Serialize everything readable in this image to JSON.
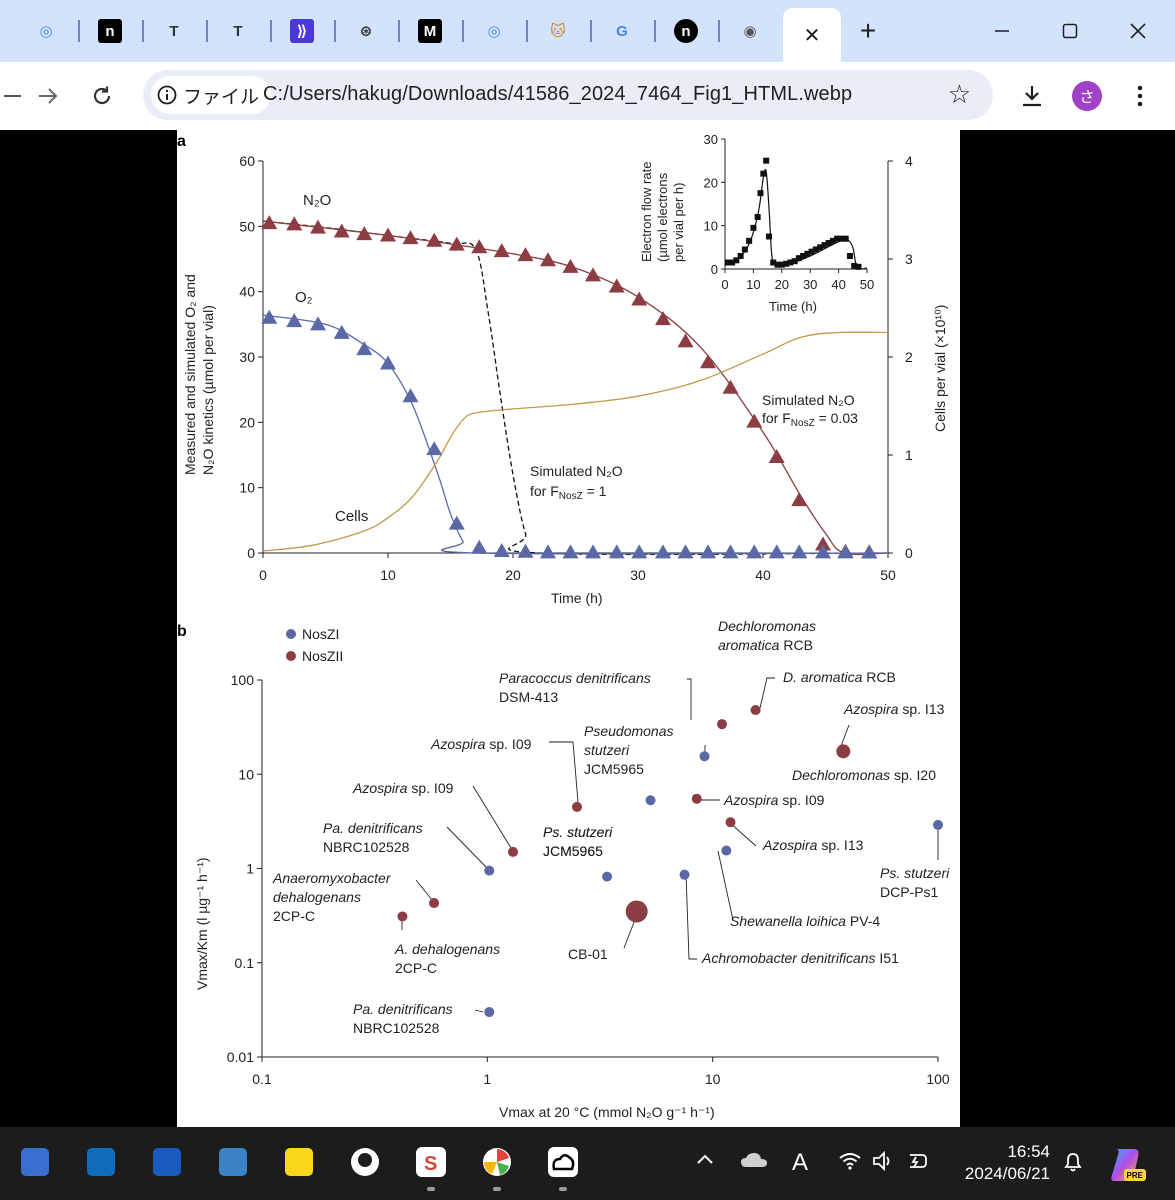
{
  "browser": {
    "tabs": [
      {
        "icon": "pond-icon",
        "glyph": "◎",
        "color": "#3d8fe0"
      },
      {
        "icon": "note-n-icon",
        "glyph": "n",
        "color": "#000000"
      },
      {
        "icon": "text-t-icon",
        "glyph": "T",
        "color": "#333333"
      },
      {
        "icon": "text-t-icon",
        "glyph": "T",
        "color": "#333333"
      },
      {
        "icon": "arrow-chevrons-icon",
        "glyph": "⟫",
        "color": "#4a38d8"
      },
      {
        "icon": "openai-icon",
        "glyph": "⊛",
        "color": "#333333"
      },
      {
        "icon": "m-logo-icon",
        "glyph": "M",
        "color": "#000000"
      },
      {
        "icon": "pond-icon",
        "glyph": "◎",
        "color": "#3d8fe0"
      },
      {
        "icon": "cat-image-icon",
        "glyph": "🐱",
        "color": "#c88a2a"
      },
      {
        "icon": "google-icon",
        "glyph": "G",
        "color": "#4285f4"
      },
      {
        "icon": "n-circle-icon",
        "glyph": "n",
        "color": "#000000"
      },
      {
        "icon": "globe-icon",
        "glyph": "◉",
        "color": "#555555"
      }
    ],
    "active_tab_close": "✕",
    "new_tab": "+",
    "url_chip_label": "ファイル",
    "url": "C:/Users/hakug/Downloads/41586_2024_7464_Fig1_HTML.webp",
    "profile_initial": "さ",
    "accent": "#d3e3fd"
  },
  "figure": {
    "panel_a": {
      "label": "a",
      "left_axis_label_line1": "Measured and simulated O₂ and",
      "left_axis_label_line2": "N₂O kinetics (µmol per vial)",
      "right_axis_label": "Cells per vial (×10¹⁰)",
      "x_axis_label": "Time (h)",
      "label_n2o": "N₂O",
      "label_o2": "O₂",
      "label_cells": "Cells",
      "annot_sim1_line1": "Simulated N₂O",
      "annot_sim1_line2": "for F",
      "annot_sim1_sub": "NosZ",
      "annot_sim1_tail": " = 1",
      "annot_sim2_line1": "Simulated N₂O",
      "annot_sim2_line2": "for F",
      "annot_sim2_sub": "NosZ",
      "annot_sim2_tail": " = 0.03",
      "inset_y_label_1": "Electron flow rate",
      "inset_y_label_2": "(µmol electrons",
      "inset_y_label_3": "per vial per h)",
      "inset_x_label": "Time (h)"
    },
    "panel_b": {
      "label": "b",
      "legend": [
        {
          "name": "NosZI",
          "color": "#5a69a6"
        },
        {
          "name": "NosZII",
          "color": "#8c3c43"
        }
      ],
      "y_axis_label": "Vmax/Km (l µg⁻¹ h⁻¹)",
      "x_axis_label": "Vmax at 20 °C (mmol N₂O g⁻¹ h⁻¹)"
    },
    "colors": {
      "n2o": "#8c3c43",
      "o2": "#5a69a6",
      "cells": "#c19a49",
      "nosz1": "#5a69a6",
      "nosz2": "#8c3c43"
    }
  },
  "chart_data": [
    {
      "type": "scatter",
      "panel": "a",
      "xlabel": "Time (h)",
      "ylabel": "Measured and simulated O2 and N2O kinetics (µmol per vial)",
      "y2label": "Cells per vial (×10^10)",
      "xlim": [
        0,
        50
      ],
      "ylim": [
        0,
        60
      ],
      "y2lim": [
        0,
        4
      ],
      "x_ticks": [
        0,
        10,
        20,
        30,
        40,
        50
      ],
      "y_ticks": [
        0,
        10,
        20,
        30,
        40,
        50,
        60
      ],
      "y2_ticks": [
        0,
        1,
        2,
        3,
        4
      ],
      "series": [
        {
          "name": "N₂O",
          "marker": "triangle",
          "x": [
            0.5,
            2.5,
            4.4,
            6.3,
            8.1,
            10,
            11.8,
            13.7,
            15.5,
            17.3,
            19.1,
            21,
            22.8,
            24.6,
            26.4,
            28.3,
            30.1,
            32,
            33.8,
            35.6,
            37.4,
            39.3,
            41.1,
            42.9,
            44.8,
            46.6,
            48.5
          ],
          "y": [
            50.5,
            50.3,
            49.8,
            49.2,
            48.8,
            48.6,
            48.2,
            47.8,
            47.2,
            46.8,
            46.2,
            45.6,
            44.8,
            43.8,
            42.5,
            40.8,
            38.8,
            35.8,
            32.4,
            29.2,
            25.3,
            20.1,
            14.7,
            8.1,
            1.3,
            0.2,
            0.1
          ]
        },
        {
          "name": "O₂",
          "marker": "triangle",
          "x": [
            0.5,
            2.5,
            4.4,
            6.3,
            8.1,
            10,
            11.8,
            13.7,
            15.5,
            17.3,
            19.1,
            21,
            22.8,
            24.6,
            26.4,
            28.3,
            30.1,
            32,
            33.8,
            35.6,
            37.4,
            39.3,
            41.1,
            42.9,
            44.8,
            46.6,
            48.5
          ],
          "y": [
            36,
            35.5,
            35,
            33.7,
            31.2,
            29,
            24,
            15.9,
            4.5,
            0.8,
            0.3,
            0.2,
            0.1,
            0.1,
            0.1,
            0.1,
            0.1,
            0.1,
            0.1,
            0.1,
            0.1,
            0.1,
            0.1,
            0.1,
            0.1,
            0.1,
            0.1
          ]
        },
        {
          "name": "Simulated N₂O for FNosZ = 1",
          "style": "dashed",
          "x": [
            0,
            5,
            10,
            15,
            17,
            18,
            19,
            20,
            21,
            22,
            50
          ],
          "y": [
            50.8,
            49.8,
            48.6,
            47.4,
            46.5,
            37,
            24,
            12,
            3,
            0,
            0
          ]
        },
        {
          "name": "Simulated N₂O for FNosZ = 0.03",
          "style": "solid",
          "x": [
            0,
            10,
            20,
            25,
            30,
            35,
            40,
            43,
            45,
            46.5,
            50
          ],
          "y": [
            50.8,
            48.6,
            45.8,
            43.6,
            39.2,
            31.5,
            18.5,
            8.8,
            3,
            0,
            0
          ]
        },
        {
          "name": "O₂ fit",
          "style": "solid",
          "x": [
            0,
            5,
            8,
            10,
            12,
            14,
            15,
            16,
            17,
            50
          ],
          "y": [
            36.4,
            35,
            32,
            29,
            22.5,
            12,
            6,
            1.8,
            0,
            0
          ]
        },
        {
          "name": "Cells",
          "style": "solid",
          "axis": "y2",
          "x": [
            0,
            4,
            8,
            10,
            12,
            14,
            15,
            16,
            17,
            20,
            25,
            30,
            35,
            40,
            43,
            46,
            50
          ],
          "y": [
            0.02,
            0.08,
            0.22,
            0.36,
            0.58,
            0.95,
            1.18,
            1.36,
            1.43,
            1.47,
            1.52,
            1.6,
            1.76,
            2.03,
            2.2,
            2.25,
            2.25
          ]
        }
      ]
    },
    {
      "type": "scatter",
      "panel": "a-inset",
      "xlabel": "Time (h)",
      "ylabel": "Electron flow rate (µmol electrons per vial per h)",
      "xlim": [
        0,
        50
      ],
      "ylim": [
        0,
        30
      ],
      "x_ticks": [
        0,
        10,
        20,
        30,
        40,
        50
      ],
      "y_ticks": [
        0,
        10,
        20,
        30
      ],
      "series": [
        {
          "name": "measured",
          "marker": "square",
          "x": [
            1,
            2.5,
            4,
            5.5,
            7,
            8.5,
            10,
            11.5,
            12.5,
            13.5,
            14.5,
            15.5,
            17,
            18.5,
            20,
            21.5,
            23,
            24.5,
            26,
            27.5,
            29,
            30.5,
            32,
            33.5,
            35,
            36.5,
            38,
            39.5,
            41,
            42.5,
            44,
            45.5,
            47
          ],
          "y": [
            1.5,
            1.5,
            2,
            3,
            4.5,
            6.5,
            9.5,
            12,
            17.5,
            22,
            25,
            7.5,
            1.5,
            1,
            1,
            1.2,
            1.5,
            1.8,
            2.5,
            3,
            3.5,
            4,
            4.5,
            5,
            5.5,
            6,
            6.5,
            7,
            7,
            7,
            3,
            0.7,
            0.5
          ]
        },
        {
          "name": "fit",
          "style": "solid",
          "x": [
            0,
            5,
            8,
            10,
            12,
            13.5,
            14.5,
            15.5,
            16.5,
            18,
            22,
            30,
            36,
            40,
            43,
            45,
            46.5,
            50
          ],
          "y": [
            0.8,
            2.5,
            5.2,
            8.5,
            14,
            21,
            22.5,
            14,
            3,
            0.7,
            1,
            3,
            5,
            6.3,
            6.8,
            5,
            0.4,
            0.2
          ]
        }
      ]
    },
    {
      "type": "scatter",
      "panel": "b",
      "x_scale": "log",
      "y_scale": "log",
      "xlim": [
        0.1,
        100
      ],
      "ylim": [
        0.01,
        100
      ],
      "x_ticks": [
        "0.1",
        "1",
        "10",
        "100"
      ],
      "y_ticks": [
        "0.01",
        "0.1",
        "1",
        "10",
        "100"
      ],
      "xlabel": "Vmax at 20 °C (mmol N2O g⁻¹ h⁻¹)",
      "ylabel": "Vmax/Km (l µg⁻¹ h⁻¹)",
      "points": [
        {
          "group": "NosZI",
          "x": 9.2,
          "y": 15.5,
          "size": "small",
          "label": [
            [
              "Pseudomonas",
              "it"
            ],
            [
              "stutzeri",
              "it"
            ],
            [
              "JCM5965",
              ""
            ]
          ]
        },
        {
          "group": "NosZI",
          "x": 5.3,
          "y": 5.3,
          "size": "small",
          "label": [
            [
              "Ps. stutzeri",
              "it"
            ],
            [
              "JCM5965",
              ""
            ]
          ]
        },
        {
          "group": "NosZI",
          "x": 1.02,
          "y": 0.95,
          "size": "small",
          "label": [
            [
              "Pa. denitrificans",
              "it"
            ],
            [
              "NBRC102528",
              ""
            ]
          ]
        },
        {
          "group": "NosZI",
          "x": 3.4,
          "y": 0.82,
          "size": "small",
          "label": [
            [
              "Ps. stutzeri",
              "it"
            ],
            [
              "JCM5965",
              ""
            ]
          ]
        },
        {
          "group": "NosZI",
          "x": 7.5,
          "y": 0.86,
          "size": "small",
          "label": [
            [
              "Achromobacter denitrificans",
              "it"
            ],
            [
              " I51",
              ""
            ]
          ]
        },
        {
          "group": "NosZI",
          "x": 11.5,
          "y": 1.55,
          "size": "small",
          "label": [
            [
              "Shewanella loihica",
              "it"
            ],
            [
              " PV-4",
              ""
            ]
          ]
        },
        {
          "group": "NosZI",
          "x": 100,
          "y": 2.9,
          "size": "small",
          "label": [
            [
              "Ps. stutzeri",
              "it"
            ],
            [
              "DCP-Ps1",
              ""
            ]
          ]
        },
        {
          "group": "NosZI",
          "x": 1.02,
          "y": 0.03,
          "size": "small",
          "label": [
            [
              "Pa. denitrificans",
              "it"
            ],
            [
              "NBRC102528",
              ""
            ]
          ]
        },
        {
          "group": "NosZII",
          "x": 11,
          "y": 34,
          "size": "small",
          "label": [
            [
              "Paracoccus denitrificans",
              "it"
            ],
            [
              "DSM-413",
              ""
            ]
          ]
        },
        {
          "group": "NosZII",
          "x": 15.5,
          "y": 48,
          "size": "small",
          "label": [
            [
              "D. aromatica",
              "it"
            ],
            [
              " RCB",
              ""
            ]
          ]
        },
        {
          "group": "NosZII",
          "x": 38,
          "y": 17.5,
          "size": "medium",
          "label": [
            [
              "Azospira",
              "it"
            ],
            [
              " sp. I13",
              ""
            ]
          ]
        },
        {
          "group": "NosZII",
          "x": 2.5,
          "y": 4.5,
          "size": "small",
          "label": [
            [
              "Azospira",
              "it"
            ],
            [
              " sp. I09",
              ""
            ]
          ]
        },
        {
          "group": "NosZII",
          "x": 1.3,
          "y": 1.5,
          "size": "small",
          "label": [
            [
              "Azospira",
              "it"
            ],
            [
              " sp. I09",
              ""
            ]
          ]
        },
        {
          "group": "NosZII",
          "x": 8.5,
          "y": 5.5,
          "size": "small",
          "label": [
            [
              "Azospira",
              "it"
            ],
            [
              " sp. I09",
              ""
            ]
          ]
        },
        {
          "group": "NosZII",
          "x": 12,
          "y": 3.1,
          "size": "small",
          "label": [
            [
              "Azospira",
              "it"
            ],
            [
              " sp. I13",
              ""
            ]
          ]
        },
        {
          "group": "NosZII",
          "x": 0.58,
          "y": 0.43,
          "size": "small",
          "label": [
            [
              "Anaeromyxobacter",
              "it"
            ],
            [
              "dehalogenans",
              "it"
            ],
            [
              "2CP-C",
              ""
            ]
          ]
        },
        {
          "group": "NosZII",
          "x": 0.42,
          "y": 0.31,
          "size": "small",
          "label": [
            [
              "A. dehalogenans",
              "it"
            ],
            [
              "2CP-C",
              ""
            ]
          ]
        },
        {
          "group": "NosZII",
          "x": 4.6,
          "y": 0.35,
          "size": "large",
          "label": [
            [
              "CB-01",
              ""
            ]
          ]
        }
      ],
      "extra_labels": [
        {
          "lines": [
            [
              "Dechloromonas",
              "it"
            ],
            [
              "aromatica",
              "it"
            ],
            [
              " RCB",
              ""
            ]
          ]
        },
        {
          "lines": [
            [
              "Dechloromonas",
              "it"
            ],
            [
              " sp. I20",
              ""
            ]
          ]
        }
      ]
    }
  ],
  "taskbar": {
    "apps": [
      {
        "icon": "calculator-icon",
        "color": "#3a6fd0"
      },
      {
        "icon": "outlook-icon",
        "color": "#0f6cbd"
      },
      {
        "icon": "word-icon",
        "color": "#185abd"
      },
      {
        "icon": "notepad-icon",
        "color": "#3b82c4"
      },
      {
        "icon": "sticky-notes-icon",
        "color": "#f9d71c"
      },
      {
        "icon": "github-icon",
        "color": "#ffffff"
      },
      {
        "icon": "s-app-icon",
        "color": "#d14836"
      },
      {
        "icon": "pinwheel-icon",
        "color": "#e8a33a"
      },
      {
        "icon": "cloud-app-icon",
        "color": "#ffffff"
      }
    ],
    "time": "16:54",
    "date": "2024/06/21",
    "ime_label": "A"
  }
}
